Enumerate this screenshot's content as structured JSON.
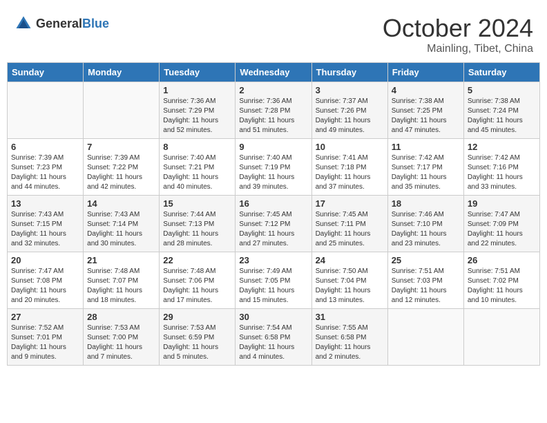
{
  "header": {
    "logo_general": "General",
    "logo_blue": "Blue",
    "month": "October 2024",
    "location": "Mainling, Tibet, China"
  },
  "weekdays": [
    "Sunday",
    "Monday",
    "Tuesday",
    "Wednesday",
    "Thursday",
    "Friday",
    "Saturday"
  ],
  "weeks": [
    [
      {
        "day": "",
        "sunrise": "",
        "sunset": "",
        "daylight": ""
      },
      {
        "day": "",
        "sunrise": "",
        "sunset": "",
        "daylight": ""
      },
      {
        "day": "1",
        "sunrise": "Sunrise: 7:36 AM",
        "sunset": "Sunset: 7:29 PM",
        "daylight": "Daylight: 11 hours and 52 minutes."
      },
      {
        "day": "2",
        "sunrise": "Sunrise: 7:36 AM",
        "sunset": "Sunset: 7:28 PM",
        "daylight": "Daylight: 11 hours and 51 minutes."
      },
      {
        "day": "3",
        "sunrise": "Sunrise: 7:37 AM",
        "sunset": "Sunset: 7:26 PM",
        "daylight": "Daylight: 11 hours and 49 minutes."
      },
      {
        "day": "4",
        "sunrise": "Sunrise: 7:38 AM",
        "sunset": "Sunset: 7:25 PM",
        "daylight": "Daylight: 11 hours and 47 minutes."
      },
      {
        "day": "5",
        "sunrise": "Sunrise: 7:38 AM",
        "sunset": "Sunset: 7:24 PM",
        "daylight": "Daylight: 11 hours and 45 minutes."
      }
    ],
    [
      {
        "day": "6",
        "sunrise": "Sunrise: 7:39 AM",
        "sunset": "Sunset: 7:23 PM",
        "daylight": "Daylight: 11 hours and 44 minutes."
      },
      {
        "day": "7",
        "sunrise": "Sunrise: 7:39 AM",
        "sunset": "Sunset: 7:22 PM",
        "daylight": "Daylight: 11 hours and 42 minutes."
      },
      {
        "day": "8",
        "sunrise": "Sunrise: 7:40 AM",
        "sunset": "Sunset: 7:21 PM",
        "daylight": "Daylight: 11 hours and 40 minutes."
      },
      {
        "day": "9",
        "sunrise": "Sunrise: 7:40 AM",
        "sunset": "Sunset: 7:19 PM",
        "daylight": "Daylight: 11 hours and 39 minutes."
      },
      {
        "day": "10",
        "sunrise": "Sunrise: 7:41 AM",
        "sunset": "Sunset: 7:18 PM",
        "daylight": "Daylight: 11 hours and 37 minutes."
      },
      {
        "day": "11",
        "sunrise": "Sunrise: 7:42 AM",
        "sunset": "Sunset: 7:17 PM",
        "daylight": "Daylight: 11 hours and 35 minutes."
      },
      {
        "day": "12",
        "sunrise": "Sunrise: 7:42 AM",
        "sunset": "Sunset: 7:16 PM",
        "daylight": "Daylight: 11 hours and 33 minutes."
      }
    ],
    [
      {
        "day": "13",
        "sunrise": "Sunrise: 7:43 AM",
        "sunset": "Sunset: 7:15 PM",
        "daylight": "Daylight: 11 hours and 32 minutes."
      },
      {
        "day": "14",
        "sunrise": "Sunrise: 7:43 AM",
        "sunset": "Sunset: 7:14 PM",
        "daylight": "Daylight: 11 hours and 30 minutes."
      },
      {
        "day": "15",
        "sunrise": "Sunrise: 7:44 AM",
        "sunset": "Sunset: 7:13 PM",
        "daylight": "Daylight: 11 hours and 28 minutes."
      },
      {
        "day": "16",
        "sunrise": "Sunrise: 7:45 AM",
        "sunset": "Sunset: 7:12 PM",
        "daylight": "Daylight: 11 hours and 27 minutes."
      },
      {
        "day": "17",
        "sunrise": "Sunrise: 7:45 AM",
        "sunset": "Sunset: 7:11 PM",
        "daylight": "Daylight: 11 hours and 25 minutes."
      },
      {
        "day": "18",
        "sunrise": "Sunrise: 7:46 AM",
        "sunset": "Sunset: 7:10 PM",
        "daylight": "Daylight: 11 hours and 23 minutes."
      },
      {
        "day": "19",
        "sunrise": "Sunrise: 7:47 AM",
        "sunset": "Sunset: 7:09 PM",
        "daylight": "Daylight: 11 hours and 22 minutes."
      }
    ],
    [
      {
        "day": "20",
        "sunrise": "Sunrise: 7:47 AM",
        "sunset": "Sunset: 7:08 PM",
        "daylight": "Daylight: 11 hours and 20 minutes."
      },
      {
        "day": "21",
        "sunrise": "Sunrise: 7:48 AM",
        "sunset": "Sunset: 7:07 PM",
        "daylight": "Daylight: 11 hours and 18 minutes."
      },
      {
        "day": "22",
        "sunrise": "Sunrise: 7:48 AM",
        "sunset": "Sunset: 7:06 PM",
        "daylight": "Daylight: 11 hours and 17 minutes."
      },
      {
        "day": "23",
        "sunrise": "Sunrise: 7:49 AM",
        "sunset": "Sunset: 7:05 PM",
        "daylight": "Daylight: 11 hours and 15 minutes."
      },
      {
        "day": "24",
        "sunrise": "Sunrise: 7:50 AM",
        "sunset": "Sunset: 7:04 PM",
        "daylight": "Daylight: 11 hours and 13 minutes."
      },
      {
        "day": "25",
        "sunrise": "Sunrise: 7:51 AM",
        "sunset": "Sunset: 7:03 PM",
        "daylight": "Daylight: 11 hours and 12 minutes."
      },
      {
        "day": "26",
        "sunrise": "Sunrise: 7:51 AM",
        "sunset": "Sunset: 7:02 PM",
        "daylight": "Daylight: 11 hours and 10 minutes."
      }
    ],
    [
      {
        "day": "27",
        "sunrise": "Sunrise: 7:52 AM",
        "sunset": "Sunset: 7:01 PM",
        "daylight": "Daylight: 11 hours and 9 minutes."
      },
      {
        "day": "28",
        "sunrise": "Sunrise: 7:53 AM",
        "sunset": "Sunset: 7:00 PM",
        "daylight": "Daylight: 11 hours and 7 minutes."
      },
      {
        "day": "29",
        "sunrise": "Sunrise: 7:53 AM",
        "sunset": "Sunset: 6:59 PM",
        "daylight": "Daylight: 11 hours and 5 minutes."
      },
      {
        "day": "30",
        "sunrise": "Sunrise: 7:54 AM",
        "sunset": "Sunset: 6:58 PM",
        "daylight": "Daylight: 11 hours and 4 minutes."
      },
      {
        "day": "31",
        "sunrise": "Sunrise: 7:55 AM",
        "sunset": "Sunset: 6:58 PM",
        "daylight": "Daylight: 11 hours and 2 minutes."
      },
      {
        "day": "",
        "sunrise": "",
        "sunset": "",
        "daylight": ""
      },
      {
        "day": "",
        "sunrise": "",
        "sunset": "",
        "daylight": ""
      }
    ]
  ]
}
